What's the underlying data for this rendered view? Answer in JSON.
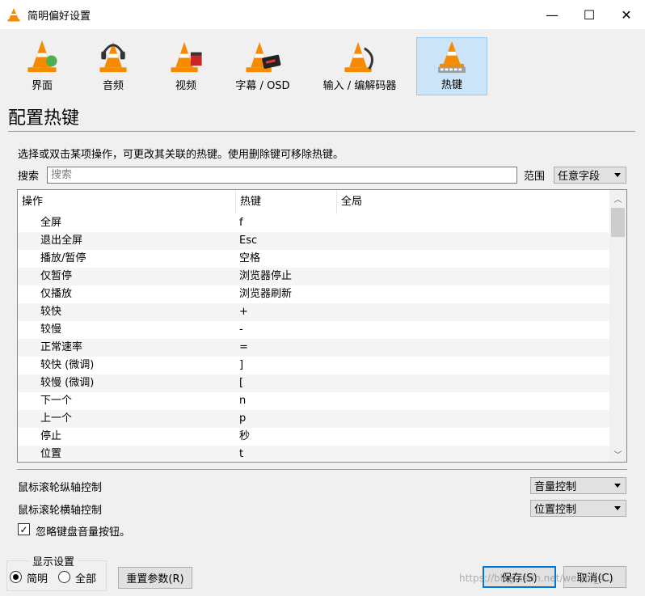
{
  "window": {
    "title": "简明偏好设置",
    "minimize": "—",
    "maximize": "☐",
    "close": "✕"
  },
  "categories": [
    {
      "label": "界面"
    },
    {
      "label": "音频"
    },
    {
      "label": "视频"
    },
    {
      "label": "字幕 / OSD"
    },
    {
      "label": "输入 / 编解码器"
    },
    {
      "label": "热键",
      "active": true
    }
  ],
  "section": {
    "title": "配置热键",
    "description": "选择或双击某项操作，可更改其关联的热键。使用删除键可移除热键。"
  },
  "search": {
    "label": "搜索",
    "placeholder": "搜索",
    "range_label": "范围",
    "range_value": "任意字段"
  },
  "table": {
    "headers": [
      "操作",
      "热键",
      "全局"
    ],
    "rows": [
      {
        "action": "全屏",
        "hotkey": "f"
      },
      {
        "action": "退出全屏",
        "hotkey": "Esc"
      },
      {
        "action": "播放/暂停",
        "hotkey": "空格"
      },
      {
        "action": "仅暂停",
        "hotkey": "浏览器停止"
      },
      {
        "action": "仅播放",
        "hotkey": "浏览器刷新"
      },
      {
        "action": "较快",
        "hotkey": "+"
      },
      {
        "action": "较慢",
        "hotkey": "-"
      },
      {
        "action": "正常速率",
        "hotkey": "="
      },
      {
        "action": "较快 (微调)",
        "hotkey": "]"
      },
      {
        "action": "较慢 (微调)",
        "hotkey": "["
      },
      {
        "action": "下一个",
        "hotkey": "n"
      },
      {
        "action": "上一个",
        "hotkey": "p"
      },
      {
        "action": "停止",
        "hotkey": "秒"
      },
      {
        "action": "位置",
        "hotkey": "t"
      }
    ]
  },
  "mouse": {
    "vertical_label": "鼠标滚轮纵轴控制",
    "vertical_value": "音量控制",
    "horizontal_label": "鼠标滚轮横轴控制",
    "horizontal_value": "位置控制"
  },
  "ignore_volume": {
    "label": "忽略键盘音量按钮。",
    "checked": true,
    "mark": "✓"
  },
  "display": {
    "group_title": "显示设置",
    "simple": "简明",
    "all": "全部"
  },
  "buttons": {
    "reset": "重置参数(R)",
    "save": "保存(S)",
    "cancel": "取消(C)"
  },
  "watermark": "https://blog.csdn.net/weixin_4..."
}
